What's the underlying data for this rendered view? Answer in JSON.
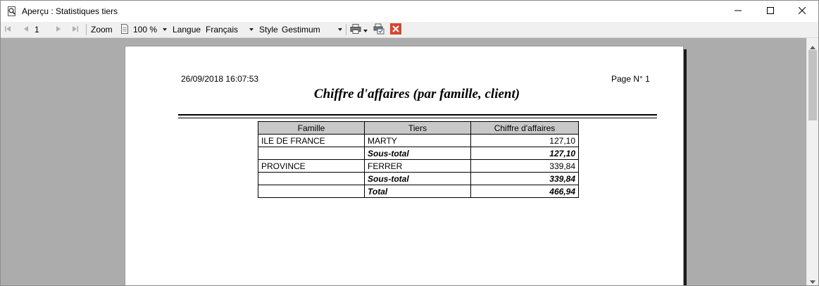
{
  "window": {
    "title": "Aperçu : Statistiques tiers",
    "icons": {
      "app": "preview-magnifier-icon",
      "minimize": "minimize-icon",
      "maximize": "maximize-icon",
      "close": "close-icon"
    }
  },
  "toolbar": {
    "page_number": "1",
    "zoom_label": "Zoom",
    "zoom_value": "100 %",
    "language_label": "Langue",
    "language_value": "Français",
    "style_label": "Style",
    "style_value": "Gestimum",
    "icons": [
      "first-page-icon",
      "previous-page-icon",
      "next-page-icon",
      "last-page-icon",
      "page-icon",
      "printer-icon",
      "print-setup-icon",
      "close-preview-icon"
    ],
    "colors": {
      "close_preview": "#d9442c"
    }
  },
  "report": {
    "date": "26/09/2018 16:07:53",
    "page_label": "Page N° 1",
    "title": "Chiffre d'affaires (par famille, client)",
    "columns": [
      "Famille",
      "Tiers",
      "Chiffre d'affaires"
    ],
    "rows": [
      {
        "famille": "ILE DE FRANCE",
        "tiers": "MARTY",
        "ca": "127,10",
        "type": "detail"
      },
      {
        "famille": "",
        "tiers": "Sous-total",
        "ca": "127,10",
        "type": "subtotal"
      },
      {
        "famille": "PROVINCE",
        "tiers": "FERRER",
        "ca": "339,84",
        "type": "detail"
      },
      {
        "famille": "",
        "tiers": "Sous-total",
        "ca": "339,84",
        "type": "subtotal"
      },
      {
        "famille": "",
        "tiers": "Total",
        "ca": "466,94",
        "type": "total"
      }
    ]
  }
}
